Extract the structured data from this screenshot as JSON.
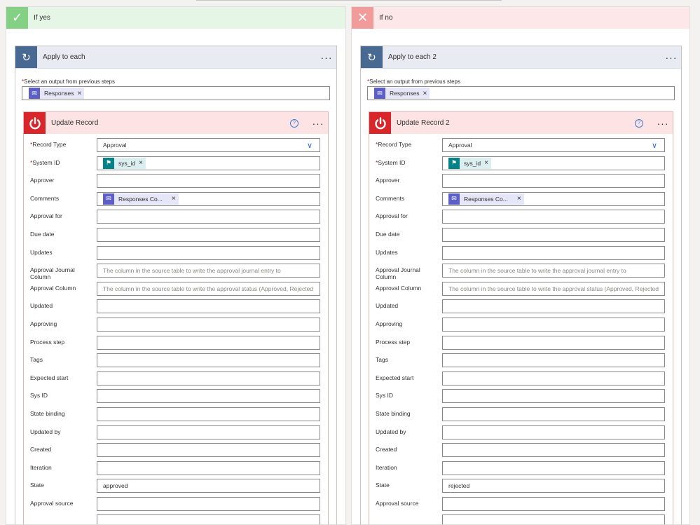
{
  "branches": [
    {
      "label": "If yes",
      "loop_title": "Apply to each",
      "select_label": "Select an output from previous steps",
      "select_token": "Responses",
      "card_title": "Update Record",
      "fields": [
        {
          "label": "Record Type",
          "required": true,
          "value": "Approval",
          "kind": "dropdown"
        },
        {
          "label": "System ID",
          "required": true,
          "token": "sys_id",
          "kind": "token"
        },
        {
          "label": "Approver",
          "value": ""
        },
        {
          "label": "Comments",
          "token": "Responses Co...",
          "kind": "token-comments"
        },
        {
          "label": "Approval for",
          "value": ""
        },
        {
          "label": "Due date",
          "value": ""
        },
        {
          "label": "Updates",
          "value": ""
        },
        {
          "label": "Approval Journal Column",
          "placeholder": "The column in the source table to write the approval journal entry to"
        },
        {
          "label": "Approval Column",
          "placeholder": "The column in the source table to write the approval status (Approved, Rejected"
        },
        {
          "label": "Updated",
          "value": ""
        },
        {
          "label": "Approving",
          "value": ""
        },
        {
          "label": "Process step",
          "value": ""
        },
        {
          "label": "Tags",
          "value": ""
        },
        {
          "label": "Expected start",
          "value": ""
        },
        {
          "label": "Sys ID",
          "value": ""
        },
        {
          "label": "State binding",
          "value": ""
        },
        {
          "label": "Updated by",
          "value": ""
        },
        {
          "label": "Created",
          "value": ""
        },
        {
          "label": "Iteration",
          "value": ""
        },
        {
          "label": "State",
          "value": "approved"
        },
        {
          "label": "Approval source",
          "value": ""
        },
        {
          "label": "",
          "value": ""
        }
      ]
    },
    {
      "label": "If no",
      "loop_title": "Apply to each 2",
      "select_label": "Select an output from previous steps",
      "select_token": "Responses",
      "card_title": "Update Record 2",
      "fields": [
        {
          "label": "Record Type",
          "required": true,
          "value": "Approval",
          "kind": "dropdown"
        },
        {
          "label": "System ID",
          "required": true,
          "token": "sys_id",
          "kind": "token"
        },
        {
          "label": "Approver",
          "value": ""
        },
        {
          "label": "Comments",
          "token": "Responses Co...",
          "kind": "token-comments"
        },
        {
          "label": "Approval for",
          "value": ""
        },
        {
          "label": "Due date",
          "value": ""
        },
        {
          "label": "Updates",
          "value": ""
        },
        {
          "label": "Approval Journal Column",
          "placeholder": "The column in the source table to write the approval journal entry to"
        },
        {
          "label": "Approval Column",
          "placeholder": "The column in the source table to write the approval status (Approved, Rejected"
        },
        {
          "label": "Updated",
          "value": ""
        },
        {
          "label": "Approving",
          "value": ""
        },
        {
          "label": "Process step",
          "value": ""
        },
        {
          "label": "Tags",
          "value": ""
        },
        {
          "label": "Expected start",
          "value": ""
        },
        {
          "label": "Sys ID",
          "value": ""
        },
        {
          "label": "State binding",
          "value": ""
        },
        {
          "label": "Updated by",
          "value": ""
        },
        {
          "label": "Created",
          "value": ""
        },
        {
          "label": "Iteration",
          "value": ""
        },
        {
          "label": "State",
          "value": "rejected"
        },
        {
          "label": "Approval source",
          "value": ""
        },
        {
          "label": "",
          "value": ""
        }
      ]
    }
  ],
  "icons": {
    "yes": "checkmark-icon",
    "no": "close-icon",
    "loop": "loop-icon",
    "connector": "servicenow-power-icon",
    "help": "help-icon",
    "more": "more-options-icon",
    "token": "approval-token-icon",
    "sys_id_token": "servicenow-token-icon"
  },
  "colors": {
    "yes_header": "#e6f6e6",
    "yes_icon": "#84d084",
    "no_header": "#fde7e9",
    "no_icon": "#f29b9b",
    "loop_icon": "#486991",
    "connector_icon": "#d9262b",
    "token_icon": "#5b5fc7",
    "teal_token_icon": "#038387"
  }
}
